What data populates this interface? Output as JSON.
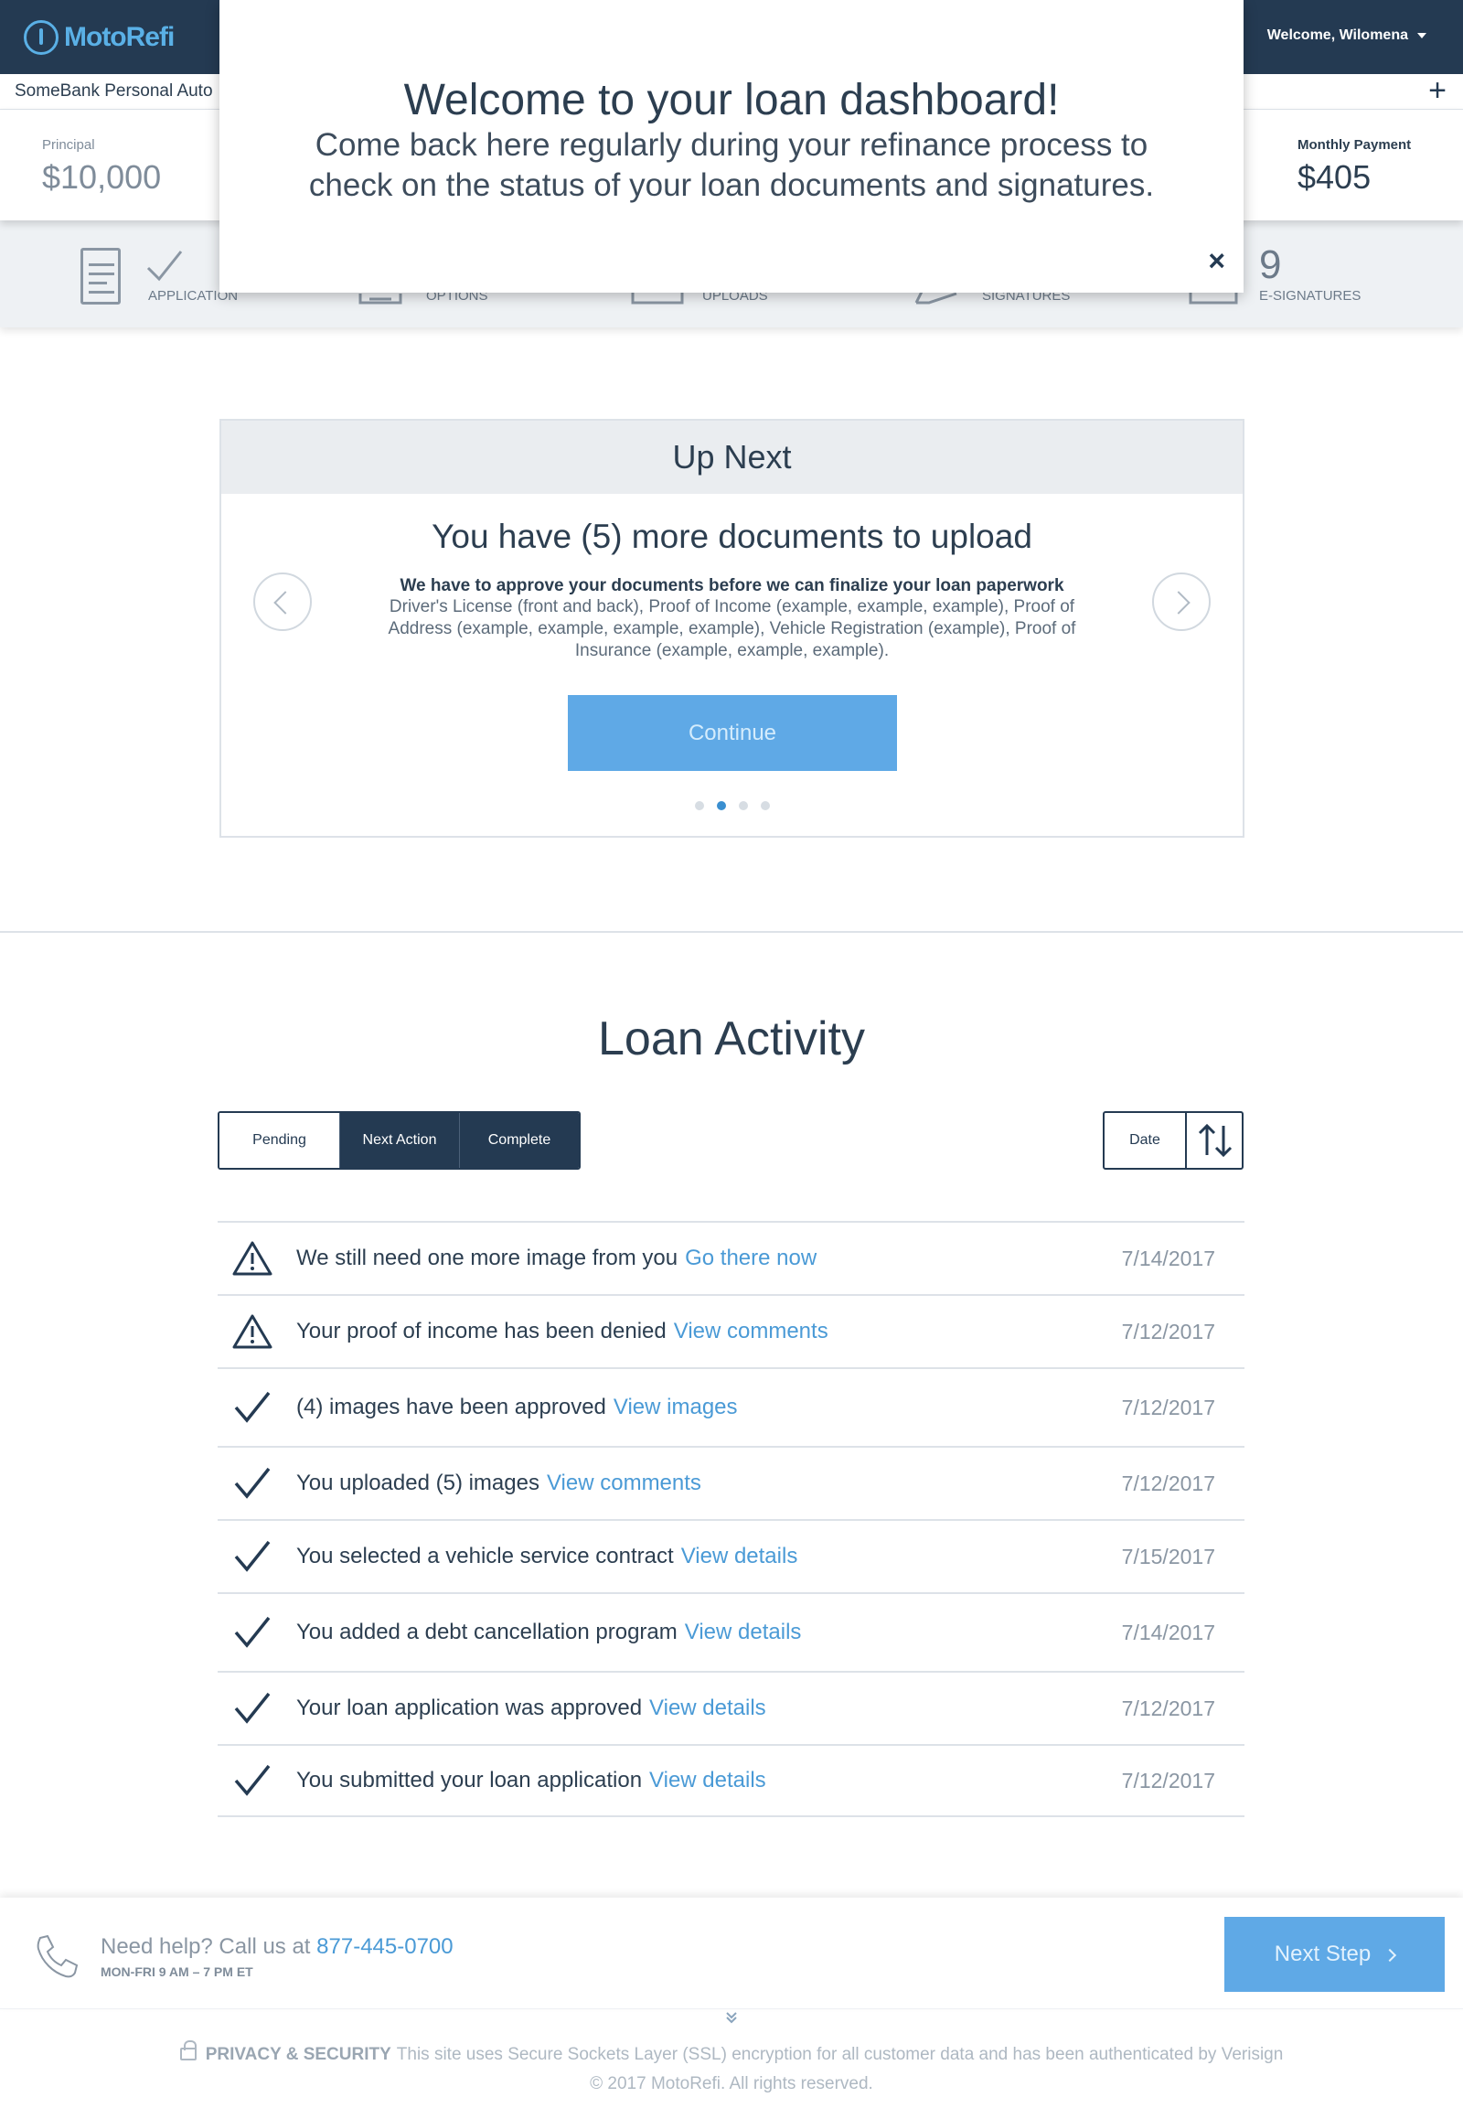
{
  "header": {
    "logo_text": "MotoRefi",
    "welcome": "Welcome, Wilomena",
    "loan_title": "SomeBank Personal Auto",
    "add_label": "+"
  },
  "stats": {
    "principal_label": "Principal",
    "principal_value": "$10,000",
    "monthly_label": "Monthly Payment",
    "monthly_value": "$405"
  },
  "steps": [
    {
      "label": "APPLICATION"
    },
    {
      "label": "OPTIONS"
    },
    {
      "label": "UPLOADS"
    },
    {
      "label": "SIGNATURES"
    },
    {
      "label": "E-SIGNATURES",
      "count": "9"
    }
  ],
  "modal": {
    "title": "Welcome to your loan dashboard!",
    "body": "Come back here regularly during your refinance process to check on the status of your loan documents and signatures.",
    "close": "×"
  },
  "up_next": {
    "header": "Up Next",
    "title": "You have (5) more documents to upload",
    "bold": "We have to approve your documents before we can finalize your loan paperwork",
    "description": "Driver's License (front and back), Proof of Income (example, example, example), Proof of Address (example, example, example, example), Vehicle Registration (example), Proof of Insurance (example, example, example).",
    "button": "Continue",
    "pages": 4,
    "active_page": 2
  },
  "loan_activity": {
    "title": "Loan Activity",
    "tabs": [
      "Pending",
      "Next Action",
      "Complete"
    ],
    "sort_label": "Date",
    "items": [
      {
        "icon": "warning-icon",
        "text": "We still need one more image from you",
        "link": "Go there now",
        "date": "7/14/2017"
      },
      {
        "icon": "warning-icon",
        "text": "Your proof of income has been denied",
        "link": "View comments",
        "date": "7/12/2017"
      },
      {
        "icon": "checkmark-icon",
        "text": "(4) images have been approved",
        "link": "View images",
        "date": "7/12/2017"
      },
      {
        "icon": "checkmark-icon",
        "text": "You uploaded (5) images",
        "link": "View comments",
        "date": "7/12/2017"
      },
      {
        "icon": "checkmark-icon",
        "text": "You selected a vehicle service contract",
        "link": "View details",
        "date": "7/15/2017"
      },
      {
        "icon": "checkmark-icon",
        "text": "You added a debt cancellation program",
        "link": "View details",
        "date": "7/14/2017"
      },
      {
        "icon": "checkmark-icon",
        "text": "Your loan application was approved",
        "link": "View details",
        "date": "7/12/2017"
      },
      {
        "icon": "checkmark-icon",
        "text": "You submitted your loan application",
        "link": "View details",
        "date": "7/12/2017"
      }
    ]
  },
  "footer": {
    "help_text": "Need help? Call us at",
    "phone": "877-445-0700",
    "hours": "MON-FRI 9 AM – 7 PM ET",
    "next_step": "Next Step",
    "privacy_heading": "PRIVACY & SECURITY",
    "privacy_text": "This site uses Secure Sockets Layer (SSL) encryption for all customer data and has been authenticated by Verisign",
    "copyright": "© 2017 MotoRefi. All rights reserved."
  },
  "colors": {
    "navy": "#243a52",
    "accent": "#5fa9e6",
    "link": "#4a9ad6"
  }
}
